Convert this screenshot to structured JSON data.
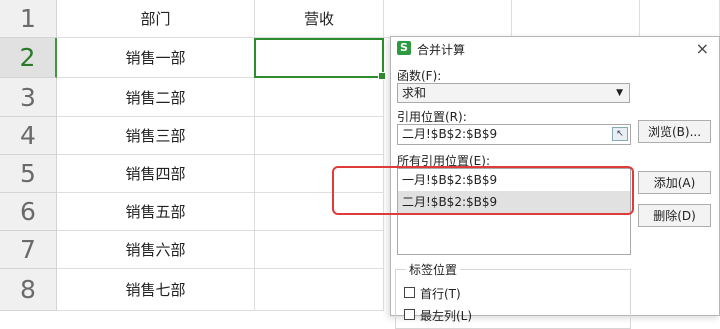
{
  "sheet": {
    "rows": [
      "1",
      "2",
      "3",
      "4",
      "5",
      "6",
      "7",
      "8"
    ],
    "headers": {
      "col_b": "部门",
      "col_c": "营收"
    },
    "departments": [
      "销售一部",
      "销售二部",
      "销售三部",
      "销售四部",
      "销售五部",
      "销售六部",
      "销售七部"
    ]
  },
  "dialog": {
    "title": "合并计算",
    "app_icon": "S",
    "close": "×",
    "function_label": "函数(F):",
    "function_value": "求和",
    "reference_label": "引用位置(R):",
    "reference_value": "二月!$B$2:$B$9",
    "browse_button": "浏览(B)...",
    "all_references_label": "所有引用位置(E):",
    "all_references": [
      "一月!$B$2:$B$9",
      "二月!$B$2:$B$9"
    ],
    "add_button": "添加(A)",
    "delete_button": "删除(D)",
    "label_position": {
      "title": "标签位置",
      "first_row": "首行(T)",
      "left_column": "最左列(L)"
    }
  },
  "colors": {
    "selection": "#2e8b2e",
    "highlight": "#e03b3b",
    "app_icon": "#2e9b42"
  }
}
